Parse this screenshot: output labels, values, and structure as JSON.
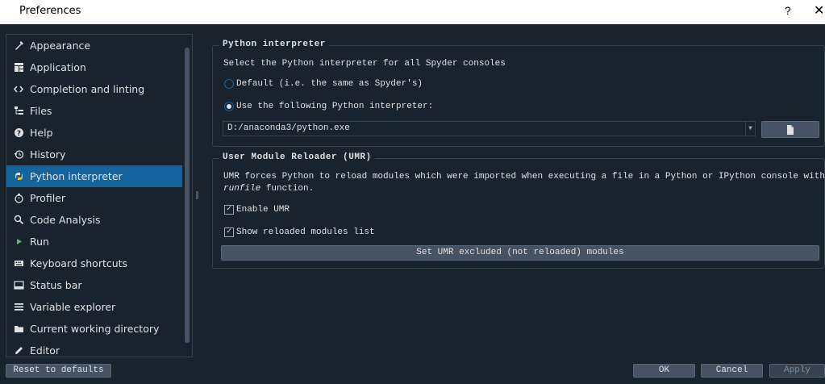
{
  "window": {
    "title": "Preferences",
    "help_label": "?",
    "close_label": "✕"
  },
  "sidebar": {
    "items": [
      {
        "label": "Appearance",
        "icon": "paintbrush-icon"
      },
      {
        "label": "Application",
        "icon": "window-grid-icon"
      },
      {
        "label": "Completion and linting",
        "icon": "code-icon"
      },
      {
        "label": "Files",
        "icon": "file-tree-icon"
      },
      {
        "label": "Help",
        "icon": "question-circle-icon"
      },
      {
        "label": "History",
        "icon": "history-icon"
      },
      {
        "label": "Python interpreter",
        "icon": "python-icon",
        "selected": true
      },
      {
        "label": "Profiler",
        "icon": "stopwatch-icon"
      },
      {
        "label": "Code Analysis",
        "icon": "magnifier-icon"
      },
      {
        "label": "Run",
        "icon": "play-icon"
      },
      {
        "label": "Keyboard shortcuts",
        "icon": "keyboard-icon"
      },
      {
        "label": "Status bar",
        "icon": "statusbar-icon"
      },
      {
        "label": "Variable explorer",
        "icon": "list-icon"
      },
      {
        "label": "Current working directory",
        "icon": "folder-icon"
      },
      {
        "label": "Editor",
        "icon": "pencil-icon"
      }
    ]
  },
  "interpreter": {
    "group_title": "Python interpreter",
    "description": "Select the Python interpreter for all Spyder consoles",
    "default_label": "Default (i.e. the same as Spyder's)",
    "custom_label": "Use the following Python interpreter:",
    "path_value": "D:/anaconda3/python.exe"
  },
  "umr": {
    "group_title": "User Module Reloader (UMR)",
    "description_line1": "UMR forces Python to reload modules which were imported when executing a file in a Python or IPython console with the",
    "description_italic": "runfile",
    "description_end": " function.",
    "enable_label": "Enable UMR",
    "show_list_label": "Show reloaded modules list",
    "excluded_button": "Set UMR excluded (not reloaded) modules"
  },
  "footer": {
    "reset_label": "Reset to defaults",
    "ok_label": "OK",
    "cancel_label": "Cancel",
    "apply_label": "Apply"
  },
  "colors": {
    "background": "#19232d",
    "selection": "#1464a0",
    "border": "#32414b",
    "button": "#455364"
  }
}
